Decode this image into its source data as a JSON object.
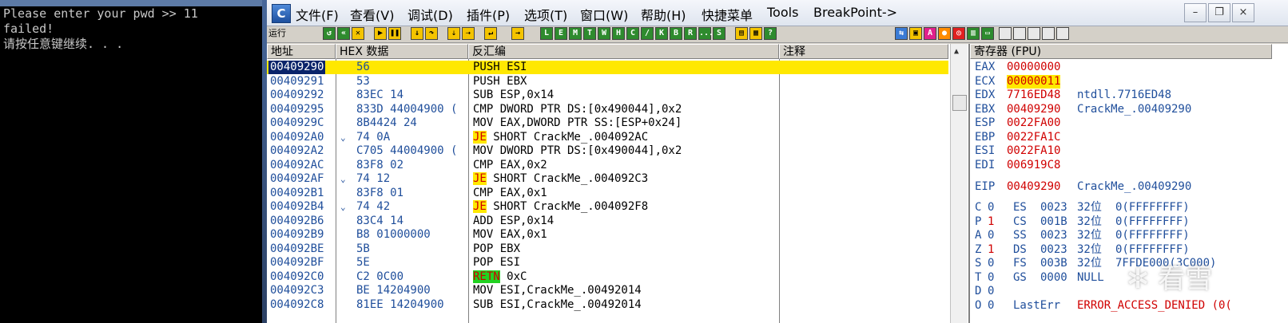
{
  "console": {
    "lines": [
      "Please enter your pwd >> 11",
      "failed!",
      "请按任意键继续. . ."
    ]
  },
  "olly": {
    "app_icon": "C",
    "menu": [
      "文件(F)",
      "查看(V)",
      "调试(D)",
      "插件(P)",
      "选项(T)",
      "窗口(W)",
      "帮助(H)",
      "快捷菜单",
      "Tools",
      "BreakPoint->"
    ],
    "window_buttons": [
      "–",
      "❐",
      "×"
    ],
    "run_status": "运行",
    "toolbar_letters": [
      "L",
      "E",
      "M",
      "T",
      "W",
      "H",
      "C",
      "/",
      "K",
      "B",
      "R",
      "...",
      "S"
    ],
    "disasm_headers": [
      "地址",
      "HEX 数据",
      "反汇编",
      "注释"
    ],
    "registers_header": "寄存器 (FPU)",
    "disasm_rows": [
      {
        "addr": "00409290",
        "hex": "56",
        "jmp": "",
        "mnem": "",
        "instr": "PUSH ESI",
        "style": "current"
      },
      {
        "addr": "00409291",
        "hex": "53",
        "jmp": "",
        "mnem": "",
        "instr": "PUSH EBX",
        "style": ""
      },
      {
        "addr": "00409292",
        "hex": "83EC 14",
        "jmp": "",
        "mnem": "",
        "instr": "SUB ESP,0x14",
        "style": ""
      },
      {
        "addr": "00409295",
        "hex": "833D 44004900 (",
        "jmp": "",
        "mnem": "",
        "instr": "CMP DWORD PTR DS:[0x490044],0x2",
        "style": ""
      },
      {
        "addr": "0040929C",
        "hex": "8B4424 24",
        "jmp": "",
        "mnem": "",
        "instr": "MOV EAX,DWORD PTR SS:[ESP+0x24]",
        "style": ""
      },
      {
        "addr": "004092A0",
        "hex": "74 0A",
        "jmp": "⌄",
        "mnem": "JE",
        "instr": " SHORT CrackMe_.004092AC",
        "style": "jump"
      },
      {
        "addr": "004092A2",
        "hex": "C705 44004900 (",
        "jmp": "",
        "mnem": "",
        "instr": "MOV DWORD PTR DS:[0x490044],0x2",
        "style": ""
      },
      {
        "addr": "004092AC",
        "hex": "83F8 02",
        "jmp": "",
        "mnem": "",
        "instr": "CMP EAX,0x2",
        "style": ""
      },
      {
        "addr": "004092AF",
        "hex": "74 12",
        "jmp": "⌄",
        "mnem": "JE",
        "instr": " SHORT CrackMe_.004092C3",
        "style": "jump"
      },
      {
        "addr": "004092B1",
        "hex": "83F8 01",
        "jmp": "",
        "mnem": "",
        "instr": "CMP EAX,0x1",
        "style": ""
      },
      {
        "addr": "004092B4",
        "hex": "74 42",
        "jmp": "⌄",
        "mnem": "JE",
        "instr": " SHORT CrackMe_.004092F8",
        "style": "jump"
      },
      {
        "addr": "004092B6",
        "hex": "83C4 14",
        "jmp": "",
        "mnem": "",
        "instr": "ADD ESP,0x14",
        "style": ""
      },
      {
        "addr": "004092B9",
        "hex": "B8 01000000",
        "jmp": "",
        "mnem": "",
        "instr": "MOV EAX,0x1",
        "style": ""
      },
      {
        "addr": "004092BE",
        "hex": "5B",
        "jmp": "",
        "mnem": "",
        "instr": "POP EBX",
        "style": ""
      },
      {
        "addr": "004092BF",
        "hex": "5E",
        "jmp": "",
        "mnem": "",
        "instr": "POP ESI",
        "style": ""
      },
      {
        "addr": "004092C0",
        "hex": "C2 0C00",
        "jmp": "",
        "mnem": "RETN",
        "instr": " 0xC",
        "style": "ret"
      },
      {
        "addr": "004092C3",
        "hex": "BE 14204900",
        "jmp": "",
        "mnem": "",
        "instr": "MOV ESI,CrackMe_.00492014",
        "style": ""
      },
      {
        "addr": "004092C8",
        "hex": "81EE 14204900",
        "jmp": "",
        "mnem": "",
        "instr": "SUB ESI,CrackMe_.00492014",
        "style": ""
      }
    ],
    "registers": [
      {
        "name": "EAX",
        "value": "00000000",
        "comment": ""
      },
      {
        "name": "ECX",
        "value": "00000011",
        "comment": ""
      },
      {
        "name": "EDX",
        "value": "7716ED48",
        "comment": "ntdll.7716ED48"
      },
      {
        "name": "EBX",
        "value": "00409290",
        "comment": "CrackMe_.00409290"
      },
      {
        "name": "ESP",
        "value": "0022FA00",
        "comment": ""
      },
      {
        "name": "EBP",
        "value": "0022FA1C",
        "comment": ""
      },
      {
        "name": "ESI",
        "value": "0022FA10",
        "comment": ""
      },
      {
        "name": "EDI",
        "value": "006919C8",
        "comment": ""
      }
    ],
    "eip": {
      "name": "EIP",
      "value": "00409290",
      "comment": "CrackMe_.00409290"
    },
    "flags": [
      {
        "flag": "C",
        "val": "0",
        "seg": "ES",
        "sel": "0023",
        "bits": "32位",
        "desc": "0(FFFFFFFF)"
      },
      {
        "flag": "P",
        "val": "1",
        "seg": "CS",
        "sel": "001B",
        "bits": "32位",
        "desc": "0(FFFFFFFF)"
      },
      {
        "flag": "A",
        "val": "0",
        "seg": "SS",
        "sel": "0023",
        "bits": "32位",
        "desc": "0(FFFFFFFF)"
      },
      {
        "flag": "Z",
        "val": "1",
        "seg": "DS",
        "sel": "0023",
        "bits": "32位",
        "desc": "0(FFFFFFFF)"
      },
      {
        "flag": "S",
        "val": "0",
        "seg": "FS",
        "sel": "003B",
        "bits": "32位",
        "desc": "7FFDE000(3C000)"
      },
      {
        "flag": "T",
        "val": "0",
        "seg": "GS",
        "sel": "0000",
        "bits": "NULL",
        "desc": ""
      },
      {
        "flag": "D",
        "val": "0",
        "seg": "",
        "sel": "",
        "bits": "",
        "desc": ""
      },
      {
        "flag": "O",
        "val": "0",
        "seg": "LastErr",
        "sel": "",
        "bits": "",
        "desc": "ERROR_ACCESS_DENIED (0("
      }
    ],
    "watermark": "看雪"
  },
  "colors": {
    "highlight_yellow": "#ffe800",
    "address_blue": "#1f4e9b",
    "register_red": "#d00000",
    "retn_green": "#21d221"
  }
}
